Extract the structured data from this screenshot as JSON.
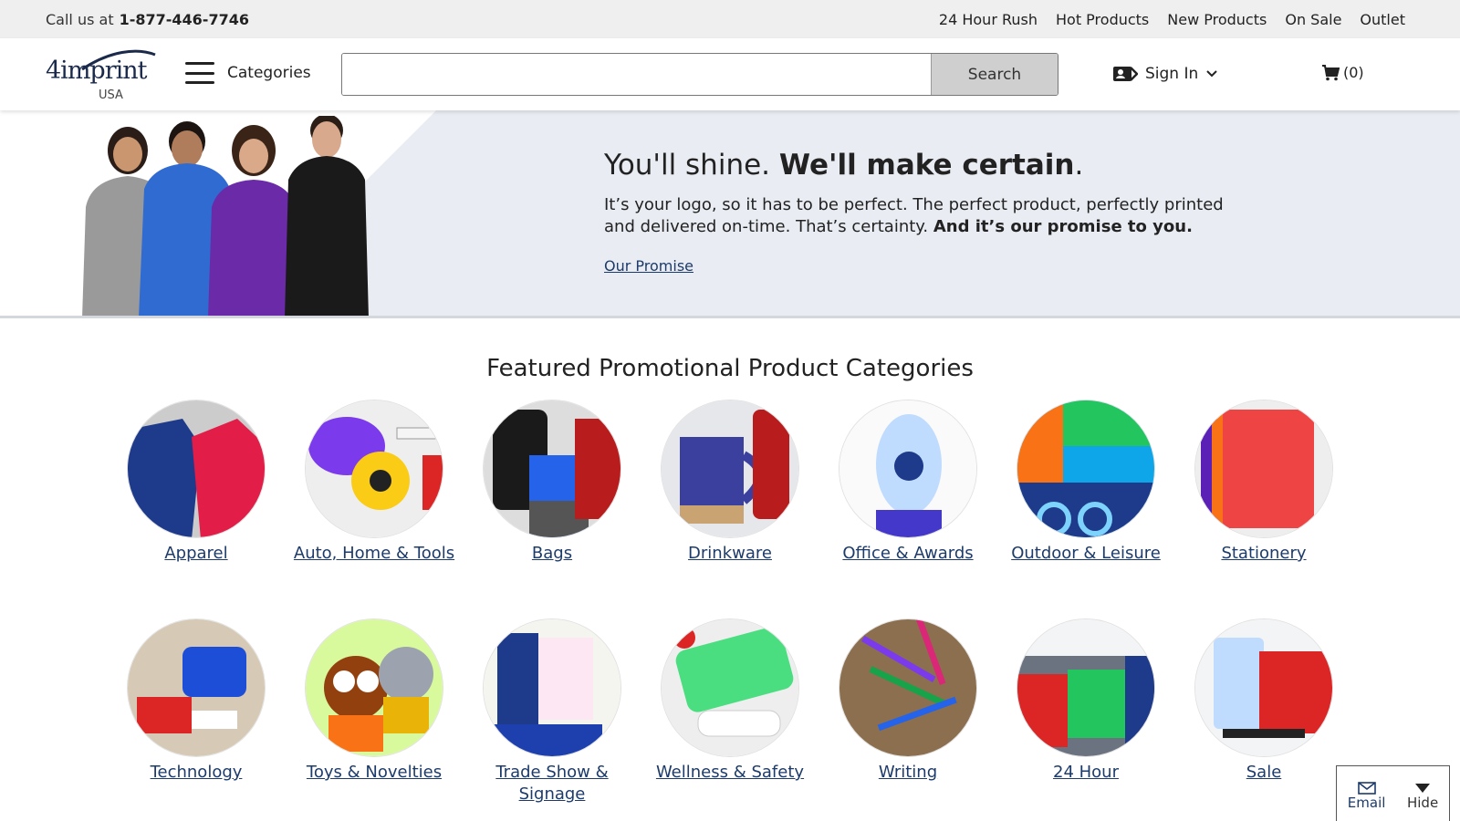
{
  "topbar": {
    "call_prefix": "Call us at",
    "phone": "1-877-446-7746",
    "links": [
      "24 Hour Rush",
      "Hot Products",
      "New Products",
      "On Sale",
      "Outlet"
    ]
  },
  "header": {
    "logo_text": "4imprint",
    "logo_country": "USA",
    "categories_label": "Categories",
    "search_value": "",
    "search_button": "Search",
    "signin_label": "Sign In",
    "cart_label": "(0)"
  },
  "hero": {
    "headline_light": "You'll shine.",
    "headline_bold": "We'll make certain",
    "headline_end": ".",
    "body_text": "It’s your logo, so it has to be perfect. The perfect product, perfectly printed and delivered on-time. That’s certainty.",
    "body_bold": "And it’s our promise to you.",
    "link": "Our Promise"
  },
  "featured": {
    "title": "Featured Promotional Product Categories",
    "categories": [
      {
        "label": "Apparel",
        "icon": "apparel-image"
      },
      {
        "label": "Auto, Home & Tools",
        "icon": "auto-home-tools-image"
      },
      {
        "label": "Bags",
        "icon": "bags-image"
      },
      {
        "label": "Drinkware",
        "icon": "drinkware-image"
      },
      {
        "label": "Office & Awards",
        "icon": "office-awards-image"
      },
      {
        "label": "Outdoor & Leisure",
        "icon": "outdoor-leisure-image"
      },
      {
        "label": "Stationery",
        "icon": "stationery-image"
      },
      {
        "label": "Technology",
        "icon": "technology-image"
      },
      {
        "label": "Toys & Novelties",
        "icon": "toys-novelties-image"
      },
      {
        "label": "Trade Show & Signage",
        "icon": "trade-show-signage-image"
      },
      {
        "label": "Wellness & Safety",
        "icon": "wellness-safety-image"
      },
      {
        "label": "Writing",
        "icon": "writing-image"
      },
      {
        "label": "24 Hour",
        "icon": "24-hour-image"
      },
      {
        "label": "Sale",
        "icon": "sale-image"
      }
    ]
  },
  "widget": {
    "email_label": "Email",
    "hide_label": "Hide"
  },
  "colors": {
    "link": "#1d3b6a",
    "topbar_bg": "#efefef",
    "hero_bg": "#e9edf3",
    "search_button_bg": "#cfcfcf"
  }
}
